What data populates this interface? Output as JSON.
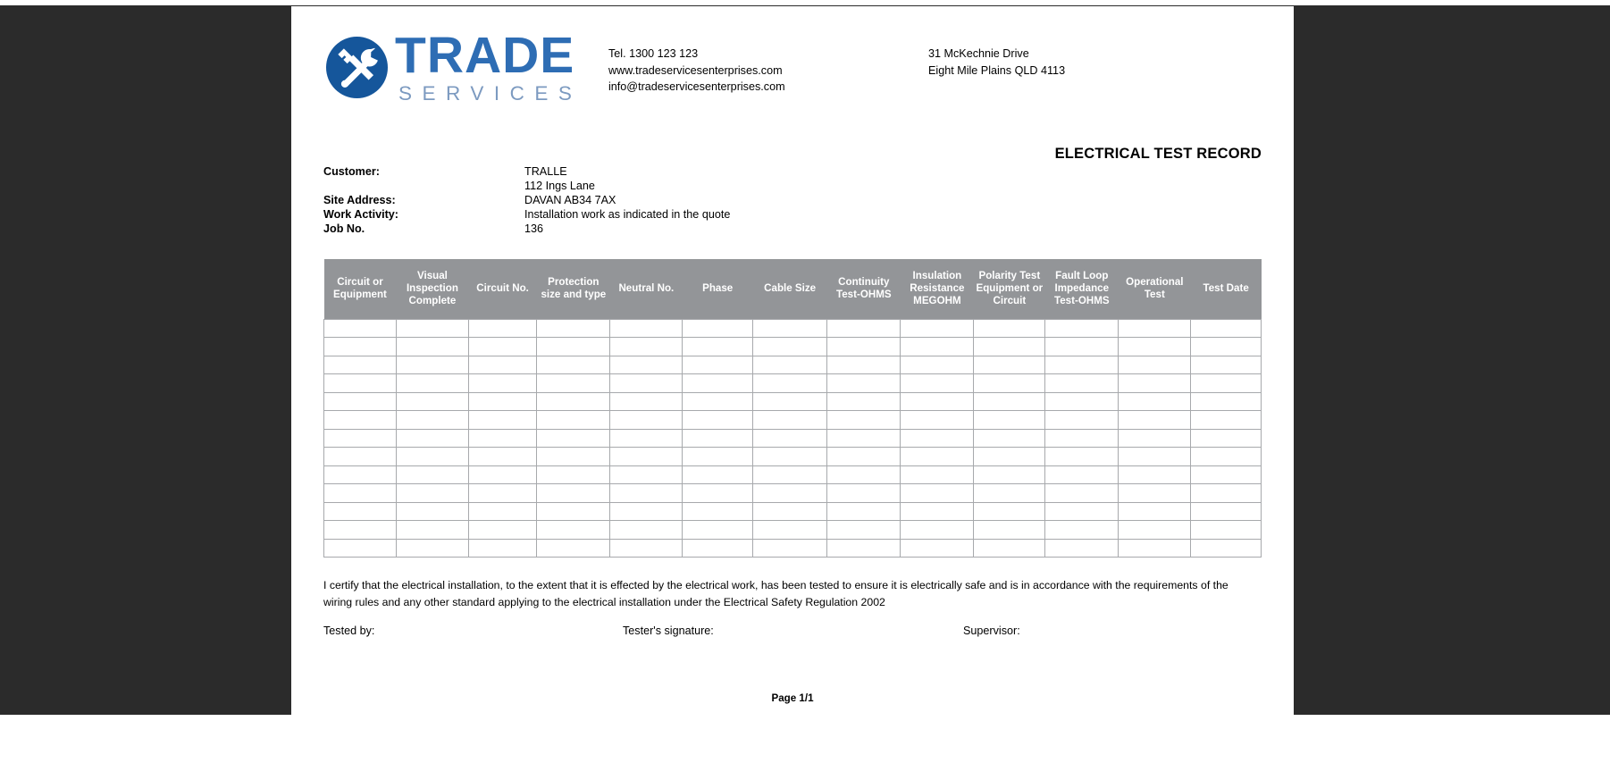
{
  "document": {
    "title": "ELECTRICAL TEST RECORD",
    "footer": "Page 1/1"
  },
  "logo": {
    "mark_icon": "hammer-wrench-circle-icon",
    "word_primary": "TRADE",
    "word_secondary": "SERVICES",
    "color_primary": "#2E6DB4",
    "color_secondary": "#7C9AC0",
    "color_circle": "#15569B"
  },
  "contact": {
    "left": [
      "Tel. 1300 123 123",
      "www.tradeservicesenterprises.com",
      "info@tradeservicesenterprises.com"
    ],
    "right": [
      "31 McKechnie Drive",
      "Eight Mile Plains QLD 4113"
    ]
  },
  "meta": {
    "rows": [
      {
        "label": "Customer:",
        "value": "TRALLE"
      },
      {
        "label": "",
        "value": "112  Ings Lane"
      },
      {
        "label": "Site Address:",
        "value": "DAVAN  AB34 7AX"
      },
      {
        "label": "Work Activity:",
        "value": "Installation work as indicated in the quote"
      },
      {
        "label": "Job No.",
        "value": "136"
      }
    ]
  },
  "table": {
    "header_bg": "#939598",
    "border_color": "#a7a9ac",
    "columns": [
      "Circuit or Equipment",
      "Visual Inspection Complete",
      "Circuit No.",
      "Protection size and type",
      "Neutral No.",
      "Phase",
      "Cable Size",
      "Continuity Test-OHMS",
      "Insulation Resistance MEGOHM",
      "Polarity Test Equipment or Circuit",
      "Fault Loop Impedance Test-OHMS",
      "Operational Test",
      "Test Date"
    ],
    "row_count": 13,
    "rows": [
      [
        "",
        "",
        "",
        "",
        "",
        "",
        "",
        "",
        "",
        "",
        "",
        "",
        ""
      ],
      [
        "",
        "",
        "",
        "",
        "",
        "",
        "",
        "",
        "",
        "",
        "",
        "",
        ""
      ],
      [
        "",
        "",
        "",
        "",
        "",
        "",
        "",
        "",
        "",
        "",
        "",
        "",
        ""
      ],
      [
        "",
        "",
        "",
        "",
        "",
        "",
        "",
        "",
        "",
        "",
        "",
        "",
        ""
      ],
      [
        "",
        "",
        "",
        "",
        "",
        "",
        "",
        "",
        "",
        "",
        "",
        "",
        ""
      ],
      [
        "",
        "",
        "",
        "",
        "",
        "",
        "",
        "",
        "",
        "",
        "",
        "",
        ""
      ],
      [
        "",
        "",
        "",
        "",
        "",
        "",
        "",
        "",
        "",
        "",
        "",
        "",
        ""
      ],
      [
        "",
        "",
        "",
        "",
        "",
        "",
        "",
        "",
        "",
        "",
        "",
        "",
        ""
      ],
      [
        "",
        "",
        "",
        "",
        "",
        "",
        "",
        "",
        "",
        "",
        "",
        "",
        ""
      ],
      [
        "",
        "",
        "",
        "",
        "",
        "",
        "",
        "",
        "",
        "",
        "",
        "",
        ""
      ],
      [
        "",
        "",
        "",
        "",
        "",
        "",
        "",
        "",
        "",
        "",
        "",
        "",
        ""
      ],
      [
        "",
        "",
        "",
        "",
        "",
        "",
        "",
        "",
        "",
        "",
        "",
        "",
        ""
      ],
      [
        "",
        "",
        "",
        "",
        "",
        "",
        "",
        "",
        "",
        "",
        "",
        "",
        ""
      ]
    ]
  },
  "certification": {
    "text": "I certify that the electrical installation, to the extent that it is effected by the electrical work, has been tested to ensure it is electrically safe and is in accordance with the requirements of the wiring rules and any other standard applying to the electrical installation under the Electrical Safety Regulation 2002"
  },
  "signatures": {
    "tested_by": "Tested by:",
    "tester_signature": "Tester's signature:",
    "supervisor": "Supervisor:"
  }
}
